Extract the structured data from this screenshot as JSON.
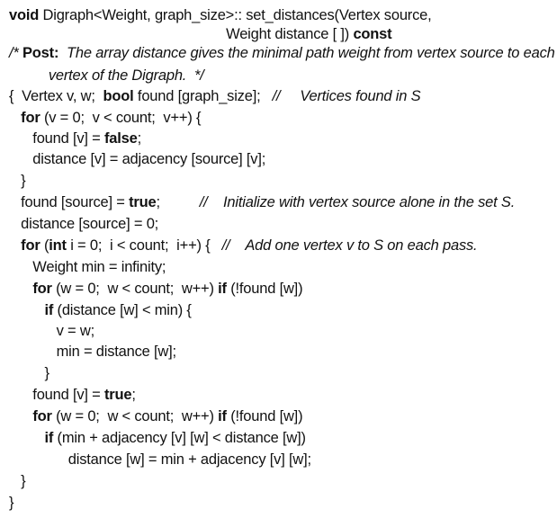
{
  "lines": [
    [
      {
        "t": "void",
        "k": true
      },
      {
        "t": " Digraph<Weight, graph_size>:: set_distances(Vertex source,"
      }
    ],
    [
      {
        "t": "                                                       Weight distance [ ]) "
      },
      {
        "t": "const",
        "k": true
      }
    ],
    [
      {
        "t": "/* ",
        "c": true
      },
      {
        "t": "Post:",
        "k": true
      },
      {
        "t": "  The array distance gives the minimal path weight from vertex source to each",
        "c": true
      }
    ],
    [
      {
        "t": "          vertex of the Digraph.  */",
        "c": true
      }
    ],
    [
      {
        "t": "{  Vertex v, w;  "
      },
      {
        "t": "bool",
        "k": true
      },
      {
        "t": " found [graph_size];   "
      },
      {
        "t": "//     Vertices found in S",
        "c": true
      }
    ],
    [
      {
        "t": "   "
      },
      {
        "t": "for",
        "k": true
      },
      {
        "t": " (v = 0;  v < count;  v++) {"
      }
    ],
    [
      {
        "t": "      found [v] = "
      },
      {
        "t": "false",
        "k": true
      },
      {
        "t": ";"
      }
    ],
    [
      {
        "t": "      distance [v] = adjacency [source] [v];"
      }
    ],
    [
      {
        "t": "   }"
      }
    ],
    [
      {
        "t": "   found [source] = "
      },
      {
        "t": "true",
        "k": true
      },
      {
        "t": ";          "
      },
      {
        "t": "//    Initialize with vertex source alone in the set S.",
        "c": true
      }
    ],
    [
      {
        "t": "   distance [source] = 0;"
      }
    ],
    [
      {
        "t": "   "
      },
      {
        "t": "for",
        "k": true
      },
      {
        "t": " ("
      },
      {
        "t": "int",
        "k": true
      },
      {
        "t": " i = 0;  i < count;  i++) {   "
      },
      {
        "t": "//    Add one vertex v to S on each pass.",
        "c": true
      }
    ],
    [
      {
        "t": "      Weight min = infinity;"
      }
    ],
    [
      {
        "t": "      "
      },
      {
        "t": "for",
        "k": true
      },
      {
        "t": " (w = 0;  w < count;  w++) "
      },
      {
        "t": "if",
        "k": true
      },
      {
        "t": " (!found [w])"
      }
    ],
    [
      {
        "t": "         "
      },
      {
        "t": "if",
        "k": true
      },
      {
        "t": " (distance [w] < min) {"
      }
    ],
    [
      {
        "t": "            v = w;"
      }
    ],
    [
      {
        "t": "            min = distance [w];"
      }
    ],
    [
      {
        "t": "         }"
      }
    ],
    [
      {
        "t": "      found [v] = "
      },
      {
        "t": "true",
        "k": true
      },
      {
        "t": ";"
      }
    ],
    [
      {
        "t": "      "
      },
      {
        "t": "for",
        "k": true
      },
      {
        "t": " (w = 0;  w < count;  w++) "
      },
      {
        "t": "if",
        "k": true
      },
      {
        "t": " (!found [w])"
      }
    ],
    [
      {
        "t": "         "
      },
      {
        "t": "if",
        "k": true
      },
      {
        "t": " (min + adjacency [v] [w] < distance [w])"
      }
    ],
    [
      {
        "t": "               distance [w] = min + adjacency [v] [w];"
      }
    ],
    [
      {
        "t": "   }"
      }
    ],
    [
      {
        "t": "}"
      }
    ]
  ]
}
